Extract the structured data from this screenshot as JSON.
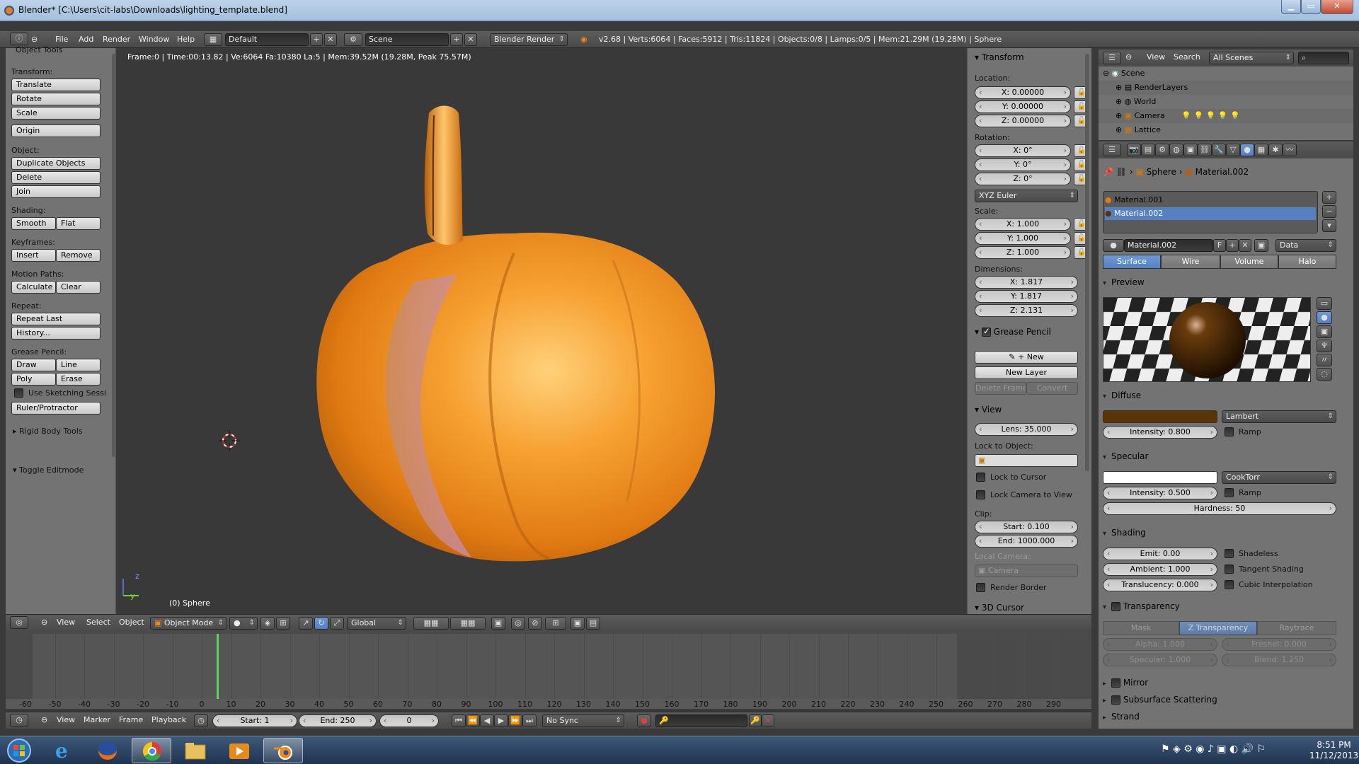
{
  "window": {
    "title": "Blender* [C:\\Users\\cit-labs\\Downloads\\lighting_template.blend]",
    "min": "▁",
    "max": "▭",
    "close": "✕"
  },
  "info_header": {
    "menus": [
      "File",
      "Add",
      "Render",
      "Window",
      "Help"
    ],
    "screen_layout": "Default",
    "scene": "Scene",
    "render_engine": "Blender Render",
    "stats": "v2.68 | Verts:6064 | Faces:5912 | Tris:11824 | Objects:0/8 | Lamps:0/5 | Mem:21.29M (19.28M) | Sphere"
  },
  "toolshelf": {
    "title": "Object Tools",
    "transform_label": "Transform:",
    "translate": "Translate",
    "rotate": "Rotate",
    "scale": "Scale",
    "origin": "Origin",
    "object_label": "Object:",
    "duplicate": "Duplicate Objects",
    "delete": "Delete",
    "join": "Join",
    "shading_label": "Shading:",
    "smooth": "Smooth",
    "flat": "Flat",
    "keyframes_label": "Keyframes:",
    "insert": "Insert",
    "remove": "Remove",
    "motion_label": "Motion Paths:",
    "calculate": "Calculate",
    "clear": "Clear",
    "repeat_label": "Repeat:",
    "repeat_last": "Repeat Last",
    "history": "History...",
    "grease_label": "Grease Pencil:",
    "draw": "Draw",
    "line": "Line",
    "poly": "Poly",
    "erase": "Erase",
    "use_sketching": "Use Sketching Sessi",
    "ruler": "Ruler/Protractor",
    "rigid_body": "Rigid Body Tools",
    "toggle_editmode": "Toggle Editmode"
  },
  "viewport": {
    "stats": "Frame:0 | Time:00:13.82 | Ve:6064 Fa:10380 La:5 | Mem:39.52M (19.28M, Peak 75.57M)",
    "object_name": "(0) Sphere",
    "axis_z": "z",
    "axis_y": "y"
  },
  "npanel": {
    "transform": "Transform",
    "location": "Location:",
    "loc_x": "X: 0.00000",
    "loc_y": "Y: 0.00000",
    "loc_z": "Z: 0.00000",
    "rotation": "Rotation:",
    "rot_x": "X: 0°",
    "rot_y": "Y: 0°",
    "rot_z": "Z: 0°",
    "rot_mode": "XYZ Euler",
    "scale": "Scale:",
    "scale_x": "X: 1.000",
    "scale_y": "Y: 1.000",
    "scale_z": "Z: 1.000",
    "dimensions": "Dimensions:",
    "dim_x": "X: 1.817",
    "dim_y": "Y: 1.817",
    "dim_z": "Z: 2.131",
    "grease_pencil": "Grease Pencil",
    "new": "New",
    "new_layer": "New Layer",
    "delete_frame": "Delete Frame",
    "convert": "Convert",
    "view": "View",
    "lens": "Lens: 35.000",
    "lock_to_object": "Lock to Object:",
    "lock_to_cursor": "Lock to Cursor",
    "lock_camera": "Lock Camera to View",
    "clip": "Clip:",
    "clip_start": "Start: 0.100",
    "clip_end": "End: 1000.000",
    "local_camera": "Local Camera:",
    "camera": "Camera",
    "render_border": "Render Border",
    "cursor_3d": "3D Cursor"
  },
  "view_header": {
    "view": "View",
    "select": "Select",
    "object": "Object",
    "mode": "Object Mode",
    "orientation": "Global"
  },
  "timeline": {
    "ticks": [
      "-60",
      "-50",
      "-40",
      "-30",
      "-20",
      "-10",
      "0",
      "10",
      "20",
      "30",
      "40",
      "50",
      "60",
      "70",
      "80",
      "90",
      "100",
      "110",
      "120",
      "130",
      "140",
      "150",
      "160",
      "170",
      "180",
      "190",
      "200",
      "210",
      "220",
      "230",
      "240",
      "250",
      "260",
      "270",
      "280",
      "290"
    ],
    "view": "View",
    "marker": "Marker",
    "frame": "Frame",
    "playback": "Playback",
    "start": "Start: 1",
    "end": "End: 250",
    "current": "0",
    "sync": "No Sync"
  },
  "outliner": {
    "view": "View",
    "search": "Search",
    "scenes": "All Scenes",
    "rows": [
      "Scene",
      "RenderLayers",
      "World",
      "Camera",
      "Lattice"
    ]
  },
  "properties": {
    "object": "Sphere",
    "material": "Material.002",
    "slots": [
      "Material.001",
      "Material.002"
    ],
    "mat_field": "Material.002",
    "fake_user": "F",
    "link": "Data",
    "tabs": [
      "Surface",
      "Wire",
      "Volume",
      "Halo"
    ],
    "preview": "Preview",
    "diffuse": "Diffuse",
    "diffuse_color": "#5a3404",
    "diffuse_shader": "Lambert",
    "diffuse_intensity": "Intensity: 0.800",
    "ramp": "Ramp",
    "specular": "Specular",
    "specular_color": "#ffffff",
    "specular_shader": "CookTorr",
    "specular_intensity": "Intensity: 0.500",
    "hardness": "Hardness: 50",
    "shading": "Shading",
    "emit": "Emit: 0.00",
    "ambient": "Ambient: 1.000",
    "translucency": "Translucency: 0.000",
    "shadeless": "Shadeless",
    "tangent": "Tangent Shading",
    "cubic": "Cubic Interpolation",
    "transparency": "Transparency",
    "trans_tabs": [
      "Mask",
      "Z Transparency",
      "Raytrace"
    ],
    "alpha": "Alpha: 1.000",
    "fresnel": "Fresnel: 0.000",
    "spec_t": "Specular: 1.000",
    "blend": "Blend: 1.250",
    "mirror": "Mirror",
    "sss": "Subsurface Scattering",
    "strand": "Strand"
  },
  "taskbar": {
    "time": "8:51 PM",
    "date": "11/12/2013"
  },
  "colors": {
    "accent": "#5680c0",
    "pumpkin": "#f08a1c",
    "current_frame": "#5fd35f"
  }
}
